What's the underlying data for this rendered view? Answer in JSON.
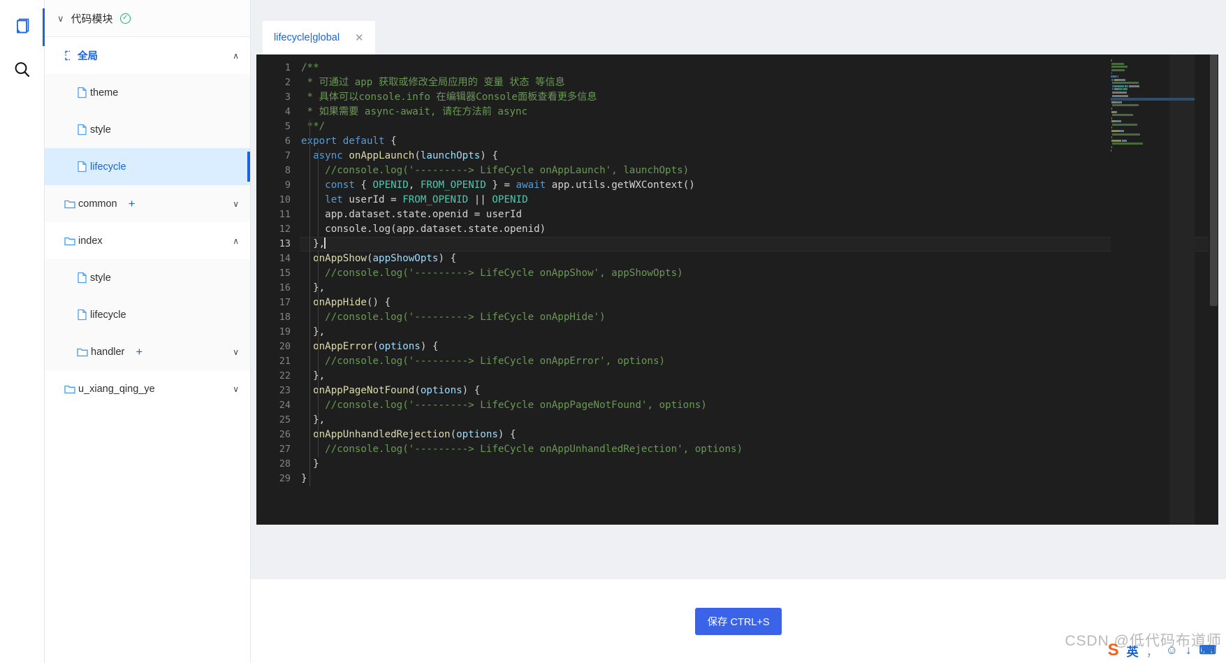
{
  "rail": {
    "items": [
      {
        "name": "pages-icon",
        "label": "",
        "active": true
      },
      {
        "name": "search-icon",
        "label": "",
        "active": false
      }
    ]
  },
  "tree": {
    "header": {
      "title": "代码模块",
      "caret": "∨",
      "status": "✓"
    },
    "nodes": [
      {
        "label": "全局",
        "type": "module",
        "indent": 1,
        "chev": "∧",
        "plus": "",
        "style": "white blue",
        "selected": false
      },
      {
        "label": "theme",
        "type": "file",
        "indent": 2,
        "chev": "",
        "plus": "",
        "style": "alt",
        "selected": false
      },
      {
        "label": "style",
        "type": "file",
        "indent": 2,
        "chev": "",
        "plus": "",
        "style": "alt",
        "selected": false
      },
      {
        "label": "lifecycle",
        "type": "file",
        "indent": 2,
        "chev": "",
        "plus": "",
        "style": "sel",
        "selected": true
      },
      {
        "label": "common",
        "type": "folder",
        "indent": 1,
        "chev": "∨",
        "plus": "+",
        "style": "alt",
        "selected": false
      },
      {
        "label": "index",
        "type": "folder",
        "indent": 1,
        "chev": "∧",
        "plus": "",
        "style": "white",
        "selected": false
      },
      {
        "label": "style",
        "type": "file",
        "indent": 2,
        "chev": "",
        "plus": "",
        "style": "alt",
        "selected": false
      },
      {
        "label": "lifecycle",
        "type": "file",
        "indent": 2,
        "chev": "",
        "plus": "",
        "style": "alt",
        "selected": false
      },
      {
        "label": "handler",
        "type": "folder",
        "indent": 2,
        "chev": "∨",
        "plus": "+",
        "style": "alt",
        "selected": false
      },
      {
        "label": "u_xiang_qing_ye",
        "type": "folder",
        "indent": 1,
        "chev": "∨",
        "plus": "",
        "style": "white",
        "selected": false
      }
    ]
  },
  "editor": {
    "tab": {
      "label": "lifecycle|global",
      "close": "✕"
    },
    "current_line": 13,
    "lines": [
      {
        "n": 1,
        "tokens": [
          {
            "t": "/**",
            "c": "cmt"
          }
        ]
      },
      {
        "n": 2,
        "tokens": [
          {
            "t": " * 可通过 app 获取或修改全局应用的 变量 状态 等信息",
            "c": "cmt"
          }
        ]
      },
      {
        "n": 3,
        "tokens": [
          {
            "t": " * 具体可以console.info 在编辑器Console面板查看更多信息",
            "c": "cmt"
          }
        ]
      },
      {
        "n": 4,
        "tokens": [
          {
            "t": " * 如果需要 async-await, 请在方法前 async",
            "c": "cmt"
          }
        ]
      },
      {
        "n": 5,
        "tokens": [
          {
            "t": " **/",
            "c": "cmt"
          }
        ]
      },
      {
        "n": 6,
        "tokens": [
          {
            "t": "export",
            "c": "kw"
          },
          {
            "t": " ",
            "c": "pln"
          },
          {
            "t": "default",
            "c": "kw"
          },
          {
            "t": " {",
            "c": "pln"
          }
        ]
      },
      {
        "n": 7,
        "tokens": [
          {
            "t": "  ",
            "c": "pln"
          },
          {
            "t": "async",
            "c": "kw"
          },
          {
            "t": " ",
            "c": "pln"
          },
          {
            "t": "onAppLaunch",
            "c": "fn"
          },
          {
            "t": "(",
            "c": "pln"
          },
          {
            "t": "launchOpts",
            "c": "prm"
          },
          {
            "t": ") {",
            "c": "pln"
          }
        ]
      },
      {
        "n": 8,
        "tokens": [
          {
            "t": "    //console.log('---------> LifeCycle onAppLaunch', launchOpts)",
            "c": "cmt"
          }
        ]
      },
      {
        "n": 9,
        "tokens": [
          {
            "t": "    ",
            "c": "pln"
          },
          {
            "t": "const",
            "c": "kw"
          },
          {
            "t": " { ",
            "c": "pln"
          },
          {
            "t": "OPENID",
            "c": "hl"
          },
          {
            "t": ", ",
            "c": "pln"
          },
          {
            "t": "FROM_OPENID",
            "c": "hl"
          },
          {
            "t": " } = ",
            "c": "pln"
          },
          {
            "t": "await",
            "c": "kw"
          },
          {
            "t": " app.utils.getWXContext()",
            "c": "pln"
          }
        ]
      },
      {
        "n": 10,
        "tokens": [
          {
            "t": "    ",
            "c": "pln"
          },
          {
            "t": "let",
            "c": "kw"
          },
          {
            "t": " userId = ",
            "c": "pln"
          },
          {
            "t": "FROM_OPENID",
            "c": "hl"
          },
          {
            "t": " || ",
            "c": "pln"
          },
          {
            "t": "OPENID",
            "c": "hl"
          }
        ]
      },
      {
        "n": 11,
        "tokens": [
          {
            "t": "    app.dataset.state.openid = userId",
            "c": "pln"
          }
        ]
      },
      {
        "n": 12,
        "tokens": [
          {
            "t": "    console.log(app.dataset.state.openid)",
            "c": "pln"
          }
        ]
      },
      {
        "n": 13,
        "tokens": [
          {
            "t": "  },",
            "c": "pln"
          }
        ],
        "cursor": true
      },
      {
        "n": 14,
        "tokens": [
          {
            "t": "  ",
            "c": "pln"
          },
          {
            "t": "onAppShow",
            "c": "fn"
          },
          {
            "t": "(",
            "c": "pln"
          },
          {
            "t": "appShowOpts",
            "c": "prm"
          },
          {
            "t": ") {",
            "c": "pln"
          }
        ]
      },
      {
        "n": 15,
        "tokens": [
          {
            "t": "    //console.log('---------> LifeCycle onAppShow', appShowOpts)",
            "c": "cmt"
          }
        ]
      },
      {
        "n": 16,
        "tokens": [
          {
            "t": "  },",
            "c": "pln"
          }
        ]
      },
      {
        "n": 17,
        "tokens": [
          {
            "t": "  ",
            "c": "pln"
          },
          {
            "t": "onAppHide",
            "c": "fn"
          },
          {
            "t": "() {",
            "c": "pln"
          }
        ]
      },
      {
        "n": 18,
        "tokens": [
          {
            "t": "    //console.log('---------> LifeCycle onAppHide')",
            "c": "cmt"
          }
        ]
      },
      {
        "n": 19,
        "tokens": [
          {
            "t": "  },",
            "c": "pln"
          }
        ]
      },
      {
        "n": 20,
        "tokens": [
          {
            "t": "  ",
            "c": "pln"
          },
          {
            "t": "onAppError",
            "c": "fn"
          },
          {
            "t": "(",
            "c": "pln"
          },
          {
            "t": "options",
            "c": "prm"
          },
          {
            "t": ") {",
            "c": "pln"
          }
        ]
      },
      {
        "n": 21,
        "tokens": [
          {
            "t": "    //console.log('---------> LifeCycle onAppError', options)",
            "c": "cmt"
          }
        ]
      },
      {
        "n": 22,
        "tokens": [
          {
            "t": "  },",
            "c": "pln"
          }
        ]
      },
      {
        "n": 23,
        "tokens": [
          {
            "t": "  ",
            "c": "pln"
          },
          {
            "t": "onAppPageNotFound",
            "c": "fn"
          },
          {
            "t": "(",
            "c": "pln"
          },
          {
            "t": "options",
            "c": "prm"
          },
          {
            "t": ") {",
            "c": "pln"
          }
        ]
      },
      {
        "n": 24,
        "tokens": [
          {
            "t": "    //console.log('---------> LifeCycle onAppPageNotFound', options)",
            "c": "cmt"
          }
        ]
      },
      {
        "n": 25,
        "tokens": [
          {
            "t": "  },",
            "c": "pln"
          }
        ]
      },
      {
        "n": 26,
        "tokens": [
          {
            "t": "  ",
            "c": "pln"
          },
          {
            "t": "onAppUnhandledRejection",
            "c": "fn"
          },
          {
            "t": "(",
            "c": "pln"
          },
          {
            "t": "options",
            "c": "prm"
          },
          {
            "t": ") {",
            "c": "pln"
          }
        ]
      },
      {
        "n": 27,
        "tokens": [
          {
            "t": "    //console.log('---------> LifeCycle onAppUnhandledRejection', options)",
            "c": "cmt"
          }
        ]
      },
      {
        "n": 28,
        "tokens": [
          {
            "t": "  }",
            "c": "pln"
          }
        ]
      },
      {
        "n": 29,
        "tokens": [
          {
            "t": "}",
            "c": "pln"
          }
        ]
      }
    ]
  },
  "footer": {
    "save_label": "保存 CTRL+S"
  },
  "watermark": {
    "text": "CSDN @低代码布道师"
  },
  "ime": {
    "logo": "S",
    "lang": "英",
    "comma": "，",
    "emoji": "☺",
    "mic": "↓",
    "keyboard": "⌨"
  },
  "colors": {
    "accent": "#1765e0",
    "save_button": "#3b63e8",
    "selected_row": "#dbeeff",
    "editor_bg": "#1e1e1e",
    "comment": "#6a9955",
    "keyword": "#569cd6",
    "function": "#dcdcaa",
    "parameter": "#9cdcfe",
    "highlight": "#4ec9b0",
    "ok_green": "#16b364"
  }
}
